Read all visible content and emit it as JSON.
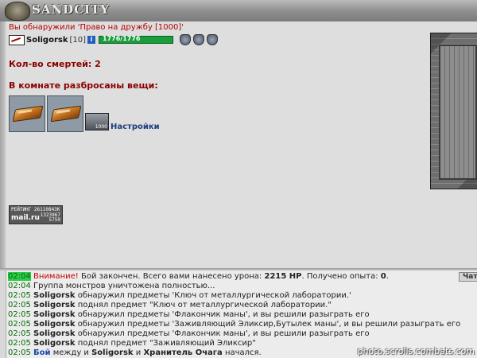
{
  "header": {
    "logo_text": "SANDCITY"
  },
  "notice": "Вы обнаружили 'Право на дружбу [1000]'",
  "player": {
    "name": "Soligorsk",
    "level": "[10]",
    "hp_text": "1776/1776",
    "hp_fraction": 1.0
  },
  "deaths_text": "Кол-во смертей: 2",
  "scattered_title": "В комнате разбросаны вещи:",
  "items": [
    "ingot",
    "ingot"
  ],
  "settings": {
    "icon_number": "1000",
    "label": "Настройки"
  },
  "rating": {
    "top": "РЕЙТИНГ 26110843K",
    "brand": "mail.ru",
    "num1": "1323967",
    "num2": "5759"
  },
  "chat": {
    "tab_label": "Чат",
    "lines": [
      {
        "time": "02:04",
        "highlight": true,
        "warn": "Внимание!",
        "text": " Бой закончен. Всего вами нанесено урона: ",
        "bold1": "2215 HP",
        "text2": ". Получено опыта: ",
        "bold2": "0",
        "text3": "."
      },
      {
        "time": "02:04",
        "text": " Группа монстров уничтожена полностью..."
      },
      {
        "time": "02:05",
        "name": "Soligorsk",
        "text": " обнаружил предметы 'Ключ от металлургической лаборатории.'"
      },
      {
        "time": "02:05",
        "name": "Soligorsk",
        "text": " поднял предмет \"Ключ от металлургической лаборатории.\""
      },
      {
        "time": "02:05",
        "name": "Soligorsk",
        "text": " обнаружил предметы 'Флакончик маны', и вы решили разыграть его"
      },
      {
        "time": "02:05",
        "name": "Soligorsk",
        "text": " обнаружил предметы 'Заживляющий Эликсир,Бутылек маны', и вы решили разыграть его"
      },
      {
        "time": "02:05",
        "name": "Soligorsk",
        "text": " обнаружил предметы 'Флакончик маны', и вы решили разыграть его"
      },
      {
        "time": "02:05",
        "name": "Soligorsk",
        "text": " поднял предмет \"Заживляющий Эликсир\""
      },
      {
        "time": "02:05",
        "fight": "Бой",
        "text": " между и ",
        "name": "Soligorsk",
        "text2": " и ",
        "name2": "Хранитель Очага",
        "text3": " начался."
      }
    ]
  },
  "watermark": "photo.scrolls.combats.com",
  "colors": {
    "hp_bar": "#1a9e3c",
    "notice": "#b30000",
    "heading": "#8b0000",
    "link": "#1c3d7a"
  }
}
